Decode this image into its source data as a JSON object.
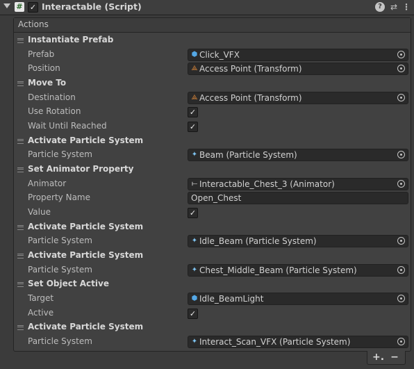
{
  "component": {
    "title": "Interactable (Script)",
    "enabled_check": "✓",
    "script_glyph": "#",
    "help_glyph": "?",
    "presets_glyph": "⇄",
    "menu_glyph": "⋮"
  },
  "list": {
    "header": "Actions",
    "add_glyph": "+.",
    "remove_glyph": "−"
  },
  "actions": [
    {
      "title": "Instantiate Prefab",
      "props": [
        {
          "label": "Prefab",
          "type": "object",
          "icon": "prefab-icon",
          "value": "Click_VFX"
        },
        {
          "label": "Position",
          "type": "object",
          "icon": "transform-icon",
          "value": "Access Point (Transform)"
        }
      ]
    },
    {
      "title": "Move To",
      "props": [
        {
          "label": "Destination",
          "type": "object",
          "icon": "transform-icon",
          "value": "Access Point (Transform)"
        },
        {
          "label": "Use Rotation",
          "type": "bool",
          "checked": true
        },
        {
          "label": "Wait Until Reached",
          "type": "bool",
          "checked": true
        }
      ]
    },
    {
      "title": "Activate Particle System",
      "props": [
        {
          "label": "Particle System",
          "type": "object",
          "icon": "particle-system-icon",
          "value": "Beam (Particle System)"
        }
      ]
    },
    {
      "title": "Set Animator Property",
      "props": [
        {
          "label": "Animator",
          "type": "object",
          "icon": "animator-icon",
          "value": "Interactable_Chest_3 (Animator)"
        },
        {
          "label": "Property Name",
          "type": "text",
          "value": "Open_Chest"
        },
        {
          "label": "Value",
          "type": "bool",
          "checked": true
        }
      ]
    },
    {
      "title": "Activate Particle System",
      "props": [
        {
          "label": "Particle System",
          "type": "object",
          "icon": "particle-system-icon",
          "value": "Idle_Beam (Particle System)"
        }
      ]
    },
    {
      "title": "Activate Particle System",
      "props": [
        {
          "label": "Particle System",
          "type": "object",
          "icon": "particle-system-icon",
          "value": "Chest_Middle_Beam (Particle System)"
        }
      ]
    },
    {
      "title": "Set Object Active",
      "props": [
        {
          "label": "Target",
          "type": "object",
          "icon": "prefab-icon",
          "value": "Idle_BeamLight"
        },
        {
          "label": "Active",
          "type": "bool",
          "checked": true
        }
      ]
    },
    {
      "title": "Activate Particle System",
      "props": [
        {
          "label": "Particle System",
          "type": "object",
          "icon": "particle-system-icon",
          "value": "Interact_Scan_VFX (Particle System)"
        }
      ]
    }
  ],
  "colors": {
    "background": "#3b3b3b",
    "field": "#2a2a2a",
    "prefab_icon": "#54a8e6",
    "transform_icon": "#e08a3a"
  }
}
